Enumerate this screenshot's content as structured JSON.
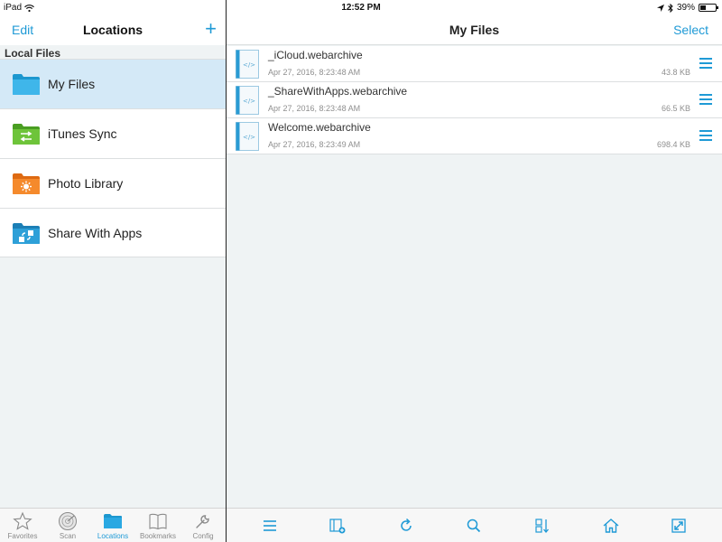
{
  "status_bar": {
    "carrier": "iPad",
    "time": "12:52 PM",
    "battery_text": "39%",
    "battery_level": 0.39
  },
  "left_nav": {
    "edit_label": "Edit",
    "title": "Locations",
    "add_label": "+"
  },
  "section_header": "Local Files",
  "locations": [
    {
      "label": "My Files",
      "icon": "folder-blue-icon",
      "color": "#29aee3",
      "selected": true
    },
    {
      "label": "iTunes Sync",
      "icon": "itunes-sync-folder-icon",
      "color": "#5cb82b",
      "selected": false
    },
    {
      "label": "Photo Library",
      "icon": "photo-library-folder-icon",
      "color": "#f28123",
      "selected": false
    },
    {
      "label": "Share With Apps",
      "icon": "share-with-apps-folder-icon",
      "color": "#2a9bd3",
      "selected": false
    }
  ],
  "tabs": [
    {
      "label": "Favorites",
      "icon": "star-icon",
      "active": false
    },
    {
      "label": "Scan",
      "icon": "radar-icon",
      "active": false
    },
    {
      "label": "Locations",
      "icon": "folder-icon",
      "active": true
    },
    {
      "label": "Bookmarks",
      "icon": "book-icon",
      "active": false
    },
    {
      "label": "Config",
      "icon": "wrench-icon",
      "active": false
    }
  ],
  "right_nav": {
    "title": "My Files",
    "select_label": "Select"
  },
  "files": [
    {
      "name": "_iCloud.webarchive",
      "date": "Apr 27, 2016, 8:23:48 AM",
      "size": "43.8 KB"
    },
    {
      "name": "_ShareWithApps.webarchive",
      "date": "Apr 27, 2016, 8:23:48 AM",
      "size": "66.5 KB"
    },
    {
      "name": "Welcome.webarchive",
      "date": "Apr 27, 2016, 8:23:49 AM",
      "size": "698.4 KB"
    }
  ],
  "toolbar_icons": [
    "list-menu-icon",
    "new-folder-icon",
    "refresh-icon",
    "search-icon",
    "sort-icon",
    "home-icon",
    "expand-icon"
  ],
  "colors": {
    "accent": "#1f9ad6",
    "selected_row": "#d4e9f7",
    "background": "#eff3f4"
  }
}
